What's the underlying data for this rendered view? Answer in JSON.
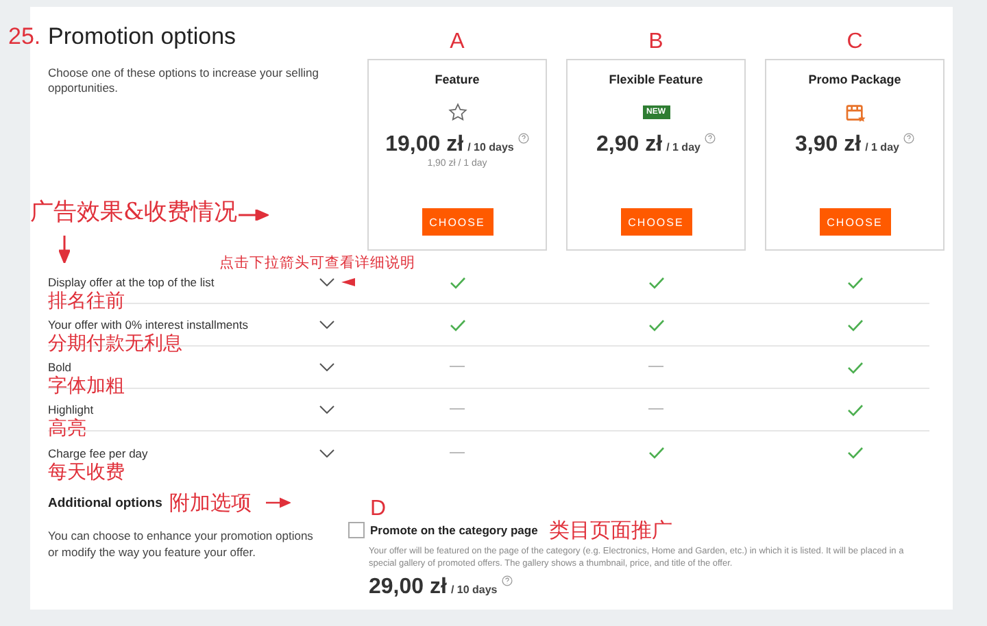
{
  "section": {
    "number": "25.",
    "title": "Promotion options",
    "description": "Choose one of these options to increase your selling opportunities."
  },
  "summary_note": "广告效果&收费情况",
  "hint_note": "点击下拉箭头可查看详细说明",
  "packages": [
    {
      "letter": "A",
      "name": "Feature",
      "kind": "star",
      "price": "19,00 zł",
      "period": "/ 10 days",
      "subprice": "1,90 zł / 1 day",
      "button": "CHOOSE"
    },
    {
      "letter": "B",
      "name": "Flexible Feature",
      "badge": "NEW",
      "price": "2,90 zł",
      "period": "/ 1 day",
      "button": "CHOOSE"
    },
    {
      "letter": "C",
      "name": "Promo Package",
      "kind": "box",
      "price": "3,90 zł",
      "period": "/ 1 day",
      "button": "CHOOSE"
    }
  ],
  "features": [
    {
      "label": "Display offer at the top of the list",
      "note": "排名往前",
      "included": [
        true,
        true,
        true
      ]
    },
    {
      "label": "Your offer with 0% interest installments",
      "note": "分期付款无利息",
      "included": [
        true,
        true,
        true
      ]
    },
    {
      "label": "Bold",
      "note": "字体加粗",
      "included": [
        false,
        false,
        true
      ]
    },
    {
      "label": "Highlight",
      "note": "高亮",
      "included": [
        false,
        false,
        true
      ]
    },
    {
      "label": "Charge fee per day",
      "note": "每天收费",
      "included": [
        false,
        true,
        true
      ]
    }
  ],
  "additional": {
    "title": "Additional options",
    "note": "附加选项",
    "description": "You can choose to enhance your promotion options or modify the way you feature your offer.",
    "option": {
      "letter": "D",
      "checked": false,
      "label": "Promote on the category page",
      "note": "类目页面推广",
      "description": "Your offer will be featured on the page of the category (e.g. Electronics, Home and Garden, etc.) in which it is listed. It will be placed in a special gallery of promoted offers. The gallery shows a thumbnail, price, and title of the offer.",
      "price": "29,00 zł",
      "period": "/ 10 days"
    }
  }
}
